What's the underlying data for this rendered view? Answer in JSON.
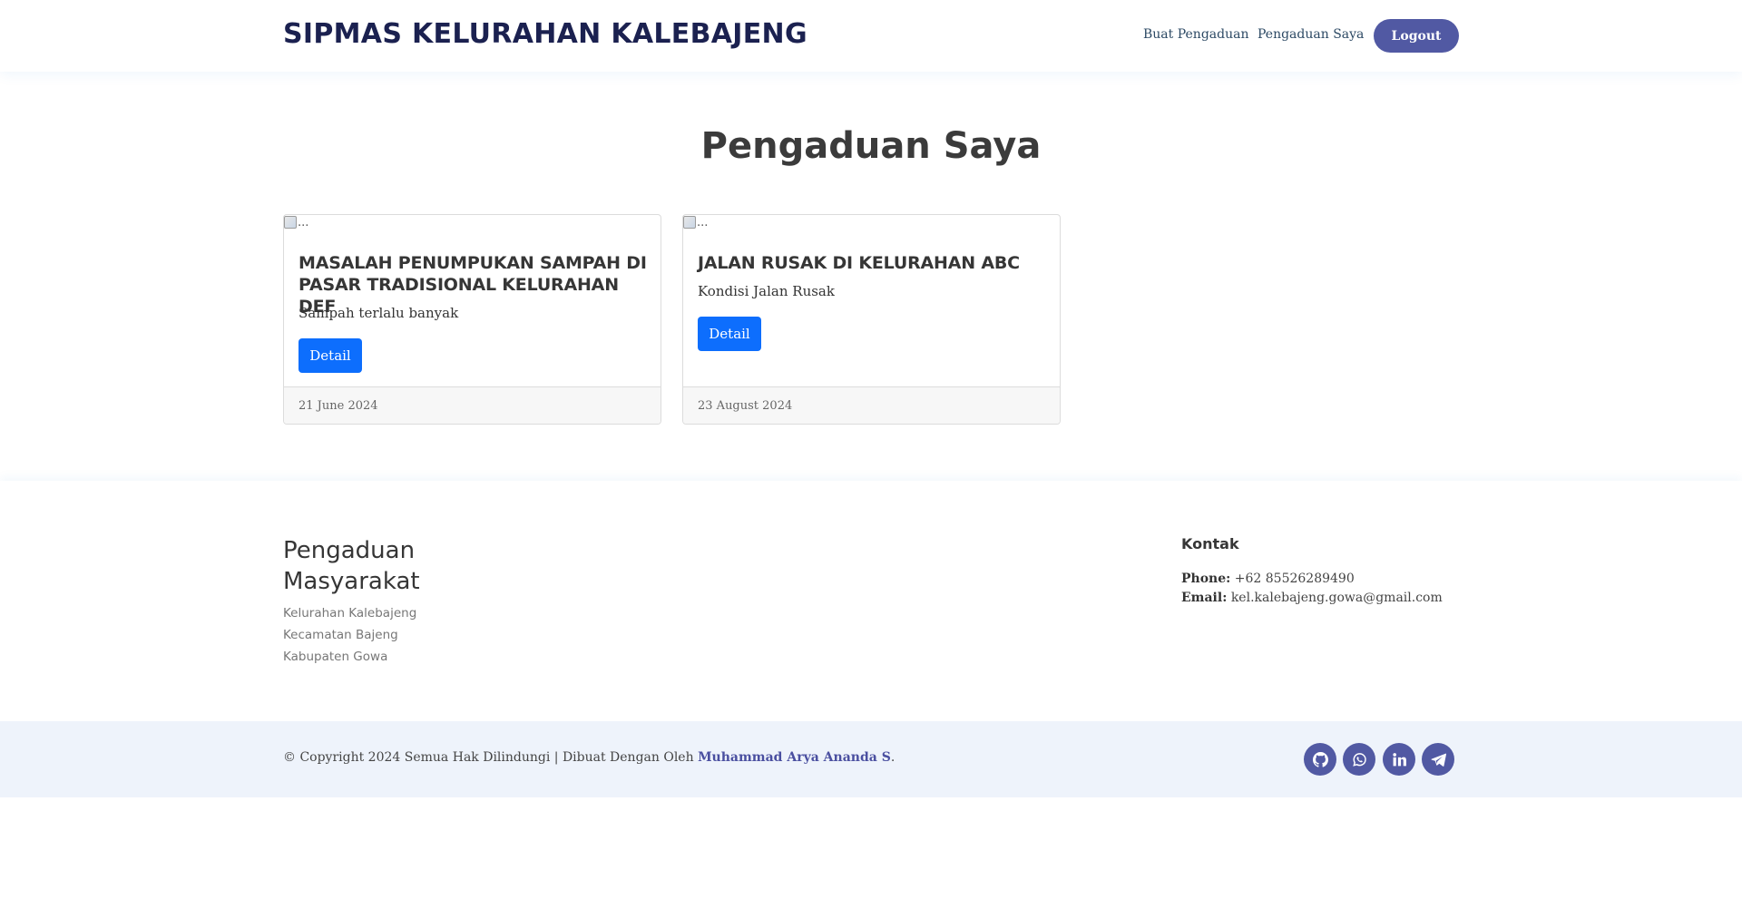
{
  "header": {
    "brand": "SIPMAS KELURAHAN KALEBAJENG",
    "nav": {
      "buat_pengaduan": "Buat Pengaduan",
      "pengaduan_saya": "Pengaduan Saya",
      "logout": "Logout"
    }
  },
  "main": {
    "title": "Pengaduan Saya",
    "cards": [
      {
        "img_alt": "...",
        "title": "MASALAH PENUMPUKAN SAMPAH DI PASAR TRADISIONAL KELURAHAN DEF",
        "text": "Sampah terlalu banyak",
        "button": "Detail",
        "date": "21 June 2024"
      },
      {
        "img_alt": "...",
        "title": "JALAN RUSAK DI KELURAHAN ABC",
        "text": "Kondisi Jalan Rusak",
        "button": "Detail",
        "date": "23 August 2024"
      }
    ]
  },
  "footer": {
    "name_line1": "Pengaduan",
    "name_line2": "Masyarakat",
    "address": [
      "Kelurahan Kalebajeng",
      "Kecamatan Bajeng",
      "Kabupaten Gowa"
    ],
    "contact": {
      "title": "Kontak",
      "phone_label": "Phone:",
      "phone": "+62 85526289490",
      "email_label": "Email:",
      "email": "kel.kalebajeng.gowa@gmail.com"
    },
    "copyright_prefix": "© Copyright 2024 Semua Hak Dilindungi | Dibuat Dengan Oleh",
    "author": "Muhammad Arya Ananda S",
    "copyright_suffix": ".",
    "social": [
      "github-icon",
      "whatsapp-icon",
      "linkedin-icon",
      "telegram-icon"
    ]
  },
  "colors": {
    "brand": "#1b2150",
    "accent": "#5159a3",
    "primary_button": "#0d6efd",
    "footer_bottom_bg": "#eef3fb"
  }
}
